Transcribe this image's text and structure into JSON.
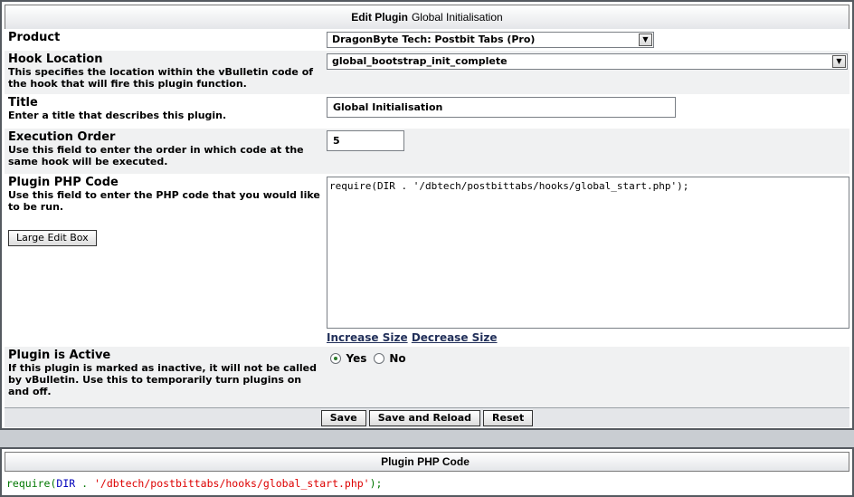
{
  "edit_panel": {
    "header_bold": "Edit Plugin",
    "header_rest": "Global Initialisation",
    "product": {
      "label": "Product",
      "value": "DragonByte Tech: Postbit Tabs (Pro)"
    },
    "hook_location": {
      "label": "Hook Location",
      "description": "This specifies the location within the vBulletin code of the hook that will fire this plugin function.",
      "value": "global_bootstrap_init_complete"
    },
    "title": {
      "label": "Title",
      "description": "Enter a title that describes this plugin.",
      "value": "Global Initialisation"
    },
    "execution_order": {
      "label": "Execution Order",
      "description": "Use this field to enter the order in which code at the same hook will be executed.",
      "value": "5"
    },
    "php_code": {
      "label": "Plugin PHP Code",
      "description": "Use this field to enter the PHP code that you would like to be run.",
      "large_edit_label": "Large Edit Box",
      "value": "require(DIR . '/dbtech/postbittabs/hooks/global_start.php');",
      "increase_label": "Increase Size",
      "decrease_label": "Decrease Size"
    },
    "active": {
      "label": "Plugin is Active",
      "description": "If this plugin is marked as inactive, it will not be called by vBulletin. Use this to temporarily turn plugins on and off.",
      "yes_label": "Yes",
      "no_label": "No",
      "selected": "Yes"
    },
    "buttons": {
      "save": "Save",
      "save_reload": "Save and Reload",
      "reset": "Reset"
    }
  },
  "code_panel": {
    "header": "Plugin PHP Code",
    "code_func": "require",
    "code_open": "(",
    "code_const": "DIR",
    "code_dot": " . ",
    "code_str": "'/dbtech/postbittabs/hooks/global_start.php'",
    "code_close": ");"
  },
  "colors": {
    "php_function": "#007700",
    "php_constant": "#0000bb",
    "php_string": "#dd0000",
    "link": "#22305a"
  }
}
